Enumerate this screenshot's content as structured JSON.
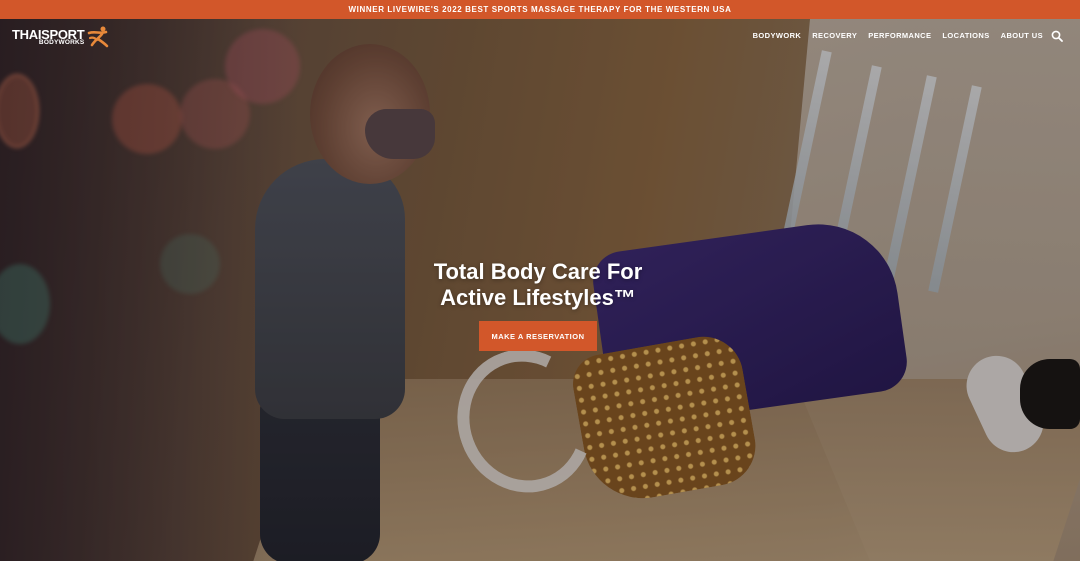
{
  "announcement": {
    "text": "WINNER LIVEWIRE'S 2022 BEST SPORTS MASSAGE THERAPY FOR THE WESTERN USA"
  },
  "header": {
    "logo": {
      "main": "THAISPORT",
      "sub": "BODYWORKS",
      "icon": "figure-mark-icon"
    },
    "nav": [
      {
        "label": "BODYWORK"
      },
      {
        "label": "RECOVERY"
      },
      {
        "label": "PERFORMANCE"
      },
      {
        "label": "LOCATIONS"
      },
      {
        "label": "ABOUT US"
      }
    ],
    "search_icon": "search-icon"
  },
  "hero": {
    "headline_line1": "Total Body Care For",
    "headline_line2": "Active Lifestyles™",
    "cta_label": "MAKE A RESERVATION",
    "background": "massage-therapy-photo"
  },
  "colors": {
    "accent": "#d2572a",
    "text": "#ffffff"
  }
}
